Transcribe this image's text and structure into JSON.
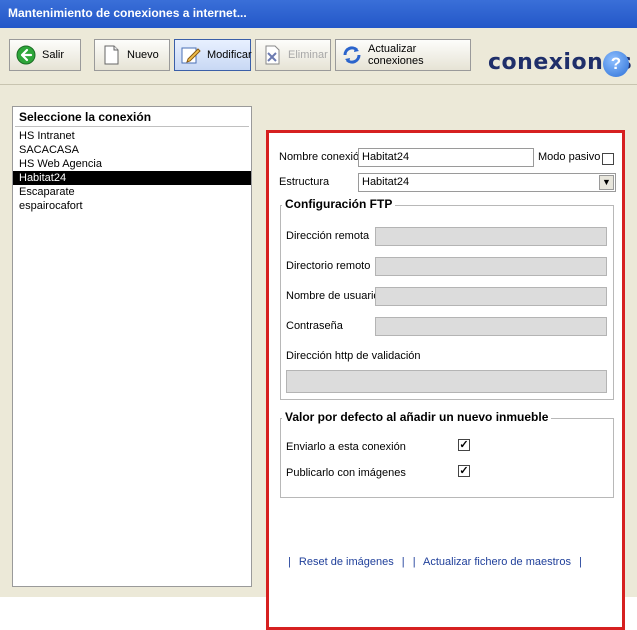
{
  "window": {
    "title": "Mantenimiento de conexiones a internet..."
  },
  "toolbar": {
    "salir": "Salir",
    "nuevo": "Nuevo",
    "modificar": "Modificar",
    "eliminar": "Eliminar",
    "actualizar": "Actualizar conexiones",
    "brand": "conexiones",
    "help": "?"
  },
  "sidebar": {
    "header": "Seleccione la conexión",
    "items": [
      "HS Intranet",
      "SACACASA",
      "HS Web Agencia",
      "Habitat24",
      "Escaparate",
      "espairocafort"
    ],
    "selected": "Habitat24"
  },
  "form": {
    "nombre_label": "Nombre conexión",
    "nombre_value": "Habitat24",
    "modo_pasivo_label": "Modo pasivo",
    "estructura_label": "Estructura",
    "estructura_value": "Habitat24",
    "ftp_title": "Configuración FTP",
    "direccion_remota_label": "Dirección remota",
    "directorio_remoto_label": "Directorio remoto",
    "usuario_label": "Nombre de usuario",
    "password_label": "Contraseña",
    "http_label": "Dirección http de validación",
    "defecto_title": "Valor por defecto al añadir un nuevo inmueble",
    "enviar_label": "Enviarlo a esta conexión",
    "enviar_mark": "✓",
    "publicar_label": "Publicarlo con imágenes",
    "publicar_mark": "✓"
  },
  "links": {
    "sep1": "|",
    "reset": "Reset de imágenes",
    "sep2": "|",
    "sep3": "|",
    "actualizar_maestros": "Actualizar fichero de maestros",
    "sep4": "|"
  }
}
